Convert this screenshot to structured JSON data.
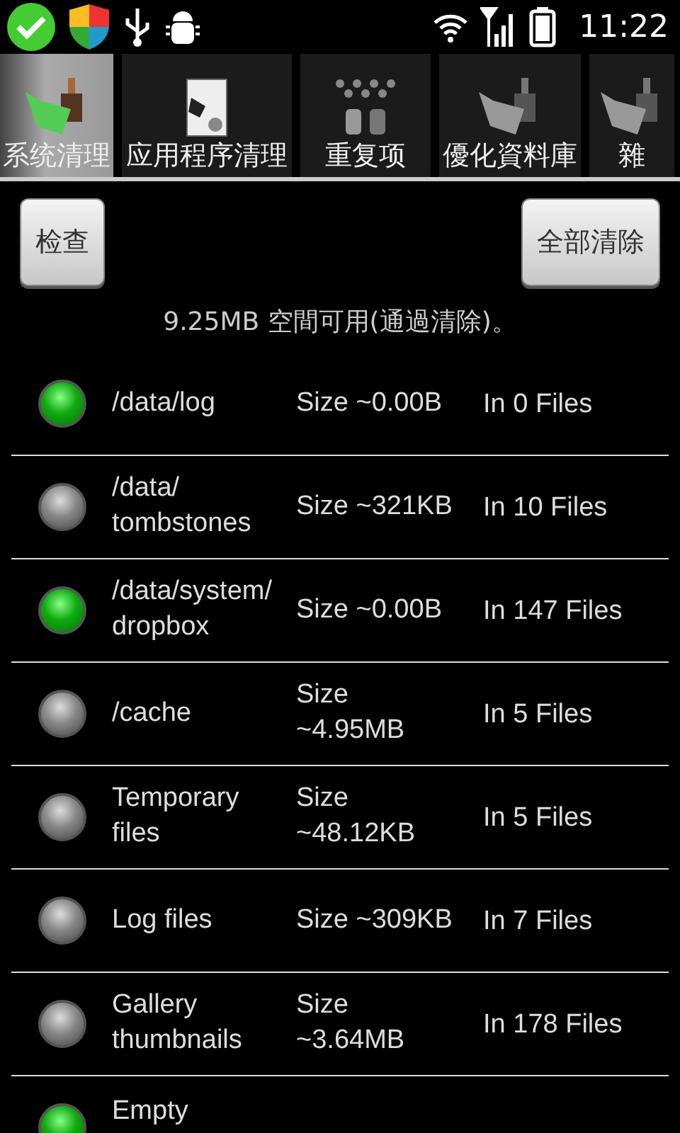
{
  "status_bar": {
    "time": "11:22"
  },
  "tabs": [
    {
      "label": "系统清理",
      "selected": true
    },
    {
      "label": "应用程序清理",
      "selected": false
    },
    {
      "label": "重复项",
      "selected": false
    },
    {
      "label": "優化資料庫",
      "selected": false
    },
    {
      "label": "雜",
      "selected": false
    }
  ],
  "buttons": {
    "check": "检查",
    "clear_all": "全部清除"
  },
  "summary": "9.25MB 空間可用(通過清除)。",
  "items": [
    {
      "name": [
        "/data/log"
      ],
      "size": [
        "Size ~0.00B"
      ],
      "files": "In 0 Files",
      "checked": true
    },
    {
      "name": [
        "/data/",
        "tombstones"
      ],
      "size": [
        "Size ~321KB"
      ],
      "files": "In 10 Files",
      "checked": false
    },
    {
      "name": [
        "/data/system/",
        "dropbox"
      ],
      "size": [
        "Size ~0.00B"
      ],
      "files": "In 147 Files",
      "checked": true
    },
    {
      "name": [
        "/cache"
      ],
      "size": [
        "Size",
        "~4.95MB"
      ],
      "files": "In 5 Files",
      "checked": false
    },
    {
      "name": [
        "Temporary",
        "files"
      ],
      "size": [
        "Size",
        "~48.12KB"
      ],
      "files": "In 5 Files",
      "checked": false
    },
    {
      "name": [
        "Log files"
      ],
      "size": [
        "Size ~309KB"
      ],
      "files": "In 7 Files",
      "checked": false
    },
    {
      "name": [
        "Gallery",
        "thumbnails"
      ],
      "size": [
        "Size",
        "~3.64MB"
      ],
      "files": "In 178 Files",
      "checked": false
    },
    {
      "name": [
        "Empty"
      ],
      "checked": true
    }
  ]
}
